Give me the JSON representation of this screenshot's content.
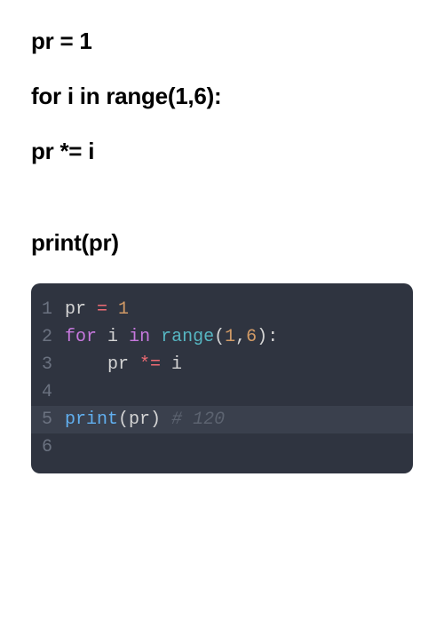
{
  "plain": {
    "line1": "pr = 1",
    "line2": "for i in range(1,6):",
    "line3": "pr *= i",
    "line4": "print(pr)"
  },
  "editor": {
    "lines": [
      {
        "num": "1",
        "tokens": [
          [
            "var",
            "pr "
          ],
          [
            "op",
            "="
          ],
          [
            "var",
            " "
          ],
          [
            "num",
            "1"
          ]
        ]
      },
      {
        "num": "2",
        "tokens": [
          [
            "kw",
            "for"
          ],
          [
            "var",
            " "
          ],
          [
            "id",
            "i"
          ],
          [
            "var",
            " "
          ],
          [
            "kw",
            "in"
          ],
          [
            "var",
            " "
          ],
          [
            "fn",
            "range"
          ],
          [
            "paren",
            "("
          ],
          [
            "num",
            "1"
          ],
          [
            "comma",
            ","
          ],
          [
            "num",
            "6"
          ],
          [
            "paren",
            ")"
          ],
          [
            "var",
            ":"
          ]
        ]
      },
      {
        "num": "3",
        "tokens": [
          [
            "var",
            "    pr "
          ],
          [
            "op",
            "*="
          ],
          [
            "var",
            " "
          ],
          [
            "id",
            "i"
          ]
        ]
      },
      {
        "num": "4",
        "tokens": []
      },
      {
        "num": "5",
        "tokens": [
          [
            "call",
            "print"
          ],
          [
            "paren",
            "("
          ],
          [
            "var",
            "pr"
          ],
          [
            "paren",
            ")"
          ],
          [
            "var",
            " "
          ],
          [
            "comment",
            "# 120"
          ]
        ],
        "highlighted": true
      },
      {
        "num": "6",
        "tokens": []
      }
    ]
  },
  "colors": {
    "editor_bg": "#2f3440",
    "gutter": "#6b7280",
    "operator": "#ef6b73",
    "number": "#d19a66",
    "keyword": "#c678dd",
    "function": "#56b6c2",
    "call": "#61afef",
    "comment": "#5c6370",
    "default": "#d4d4d4"
  }
}
